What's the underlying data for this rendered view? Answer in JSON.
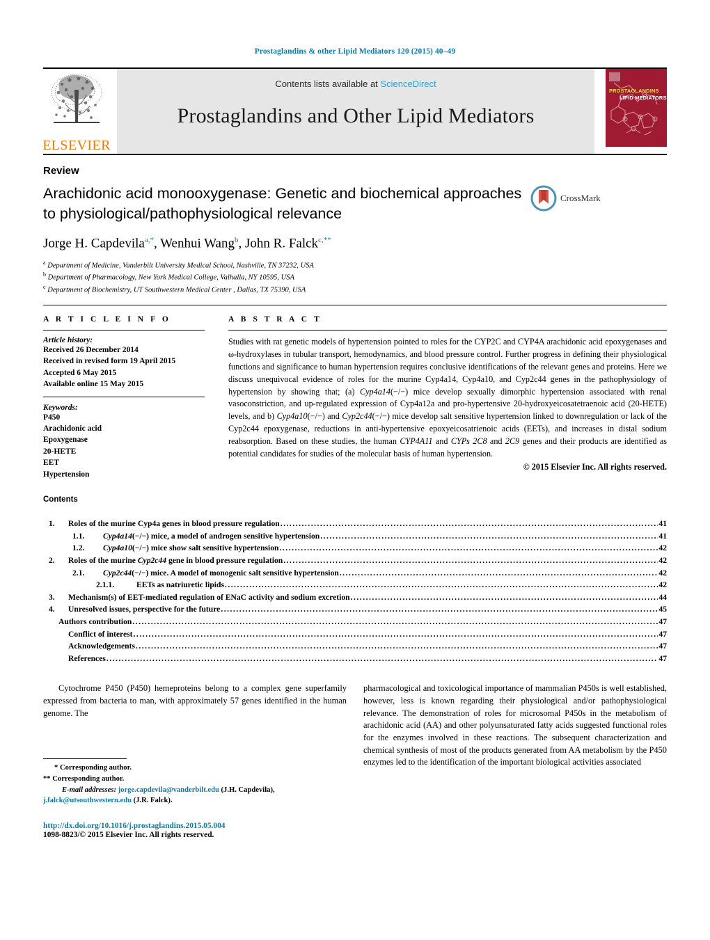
{
  "running_head": "Prostaglandins & other Lipid Mediators 120 (2015) 40–49",
  "masthead": {
    "publisher": "ELSEVIER",
    "contents_available": "Contents lists available at",
    "sciencedirect": "ScienceDirect",
    "journal_title": "Prostaglandins and Other Lipid Mediators",
    "cover_title_line1": "PROSTAGLANDINS",
    "cover_title_line2": "LIPID MEDIATORS"
  },
  "article": {
    "type_label": "Review",
    "title": "Arachidonic acid monooxygenase: Genetic and biochemical approaches to physiological/pathophysiological relevance",
    "crossmark_label": "CrossMark",
    "authors_html": "Jorge H. Capdevila<sup class=\"aff-link\">a,*</sup>, Wenhui Wang<sup class=\"aff-link\">b</sup>, John R. Falck<sup class=\"aff-link\">c,**</sup>",
    "affiliations": [
      {
        "marker": "a",
        "text": "Department of Medicine, Vanderbilt University Medical School, Nashville, TN 37232, USA"
      },
      {
        "marker": "b",
        "text": "Department of Pharmacology, New York Medical College, Valhalla, NY 10595, USA"
      },
      {
        "marker": "c",
        "text": "Department of Biochemistry, UT Southwestern Medical Center , Dallas, TX 75390, USA"
      }
    ]
  },
  "info": {
    "heading": "A R T I C L E   I N F O",
    "history_label": "Article history:",
    "history": [
      "Received 26 December 2014",
      "Received in revised form 19 April 2015",
      "Accepted 6 May 2015",
      "Available online 15 May 2015"
    ],
    "keywords_label": "Keywords:",
    "keywords": [
      "P450",
      "Arachidonic acid",
      "Epoxygenase",
      "20-HETE",
      "EET",
      "Hypertension"
    ]
  },
  "abstract": {
    "heading": "A B S T R A C T",
    "body_html": "Studies with rat genetic models of hypertension pointed to roles for the CYP2C and CYP4A arachidonic acid epoxygenases and &omega;-hydroxylases in tubular transport, hemodynamics, and blood pressure control. Further progress in defining their physiological functions and significance to human hypertension requires conclusive identifications of the relevant genes and proteins. Here we discuss unequivocal evidence of roles for the murine Cyp4a14, Cyp4a10, and Cyp2c44 genes in the pathophysiology of hypertension by showing that; (a) <i>Cyp4a14</i>(&minus;/&minus;) mice develop sexually dimorphic hypertension associated with renal vasoconstriction, and up-regulated expression of Cyp4a12a and pro-hypertensive 20-hydroxyeicosatetraenoic acid (20-HETE) levels, and b) <i>Cyp4a10</i>(&minus;/&minus;) and <i>Cyp2c44</i>(&minus;/&minus;) mice develop salt sensitive hypertension linked to downregulation or lack of the Cyp2c44 epoxygenase, reductions in anti-hypertensive epoxyeicosatrienoic acids (EETs), and increases in distal sodium reabsorption. Based on these studies, the human <i>CYP4A11</i> and <i>CYPs 2C8</i> and <i>2C9</i> genes and their products are identified as potential candidates for studies of the molecular basis of human hypertension.",
    "copyright": "© 2015 Elsevier Inc. All rights reserved."
  },
  "contents": {
    "heading": "Contents",
    "entries": [
      {
        "level": 1,
        "num": "1.",
        "label_html": "Roles of the murine Cyp4a genes in blood pressure regulation",
        "page": "41"
      },
      {
        "level": 2,
        "num": "1.1.",
        "label_html": "<i>Cyp4a14</i>(&minus;/&minus;) mice, a model of androgen sensitive hypertension",
        "page": "41"
      },
      {
        "level": 2,
        "num": "1.2.",
        "label_html": "<i>Cyp4a10</i>(&minus;/&minus;) mice show salt sensitive hypertension",
        "page": "42"
      },
      {
        "level": 1,
        "num": "2.",
        "label_html": "Roles of the murine <i>Cyp2c44</i> gene in blood pressure regulation",
        "page": "42"
      },
      {
        "level": 2,
        "num": "2.1.",
        "label_html": "<i>Cyp2c44</i>(&minus;/&minus;) mice. A model of monogenic salt sensitive hypertension",
        "page": "42"
      },
      {
        "level": 3,
        "num": "2.1.1.",
        "label_html": "EETs as natriuretic lipids",
        "page": "42"
      },
      {
        "level": 1,
        "num": "3.",
        "label_html": "Mechanism(s) of EET-mediated regulation of ENaC activity and sodium excretion",
        "page": "44"
      },
      {
        "level": 1,
        "num": "4.",
        "label_html": "Unresolved issues, perspective for the future",
        "page": "45"
      },
      {
        "level": 4,
        "num": "",
        "label_html": "Authors contribution",
        "page": "47"
      },
      {
        "level": 5,
        "num": "",
        "label_html": "Conflict of interest",
        "page": "47"
      },
      {
        "level": 5,
        "num": "",
        "label_html": "Acknowledgements",
        "page": "47"
      },
      {
        "level": 5,
        "num": "",
        "label_html": "References",
        "page": "47"
      }
    ]
  },
  "body": {
    "left_paragraph": "Cytochrome P450 (P450) hemeproteins belong to a complex gene superfamily expressed from bacteria to man, with approximately 57 genes identified in the human genome. The",
    "right_paragraph": "pharmacological and toxicological importance of mammalian P450s is well established, however, less is known regarding their physiological and/or pathophysiological relevance. The demonstration of roles for microsomal P450s in the metabolism of arachidonic acid (AA) and other polyunsaturated fatty acids suggested functional roles for the enzymes involved in these reactions. The subsequent characterization and chemical synthesis of most of the products generated from AA metabolism by the P450 enzymes led to the identification of the important biological activities associated"
  },
  "footnotes": {
    "corresponding1": "* Corresponding author.",
    "corresponding2": "** Corresponding author.",
    "email_label": "E-mail addresses:",
    "email1": "jorge.capdevila@vanderbilt.edu",
    "email1_owner": "(J.H. Capdevila),",
    "email2": "j.falck@utsouthwestern.edu",
    "email2_owner": "(J.R. Falck).",
    "doi": "http://dx.doi.org/10.1016/j.prostaglandins.2015.05.004",
    "issn_copyright": "1098-8823/© 2015 Elsevier Inc. All rights reserved."
  },
  "colors": {
    "link_blue": "#0b7cad",
    "sciencedirect_blue": "#2f9fd0",
    "elsevier_orange": "#ec7a08",
    "cover_red": "#9e1b32"
  }
}
